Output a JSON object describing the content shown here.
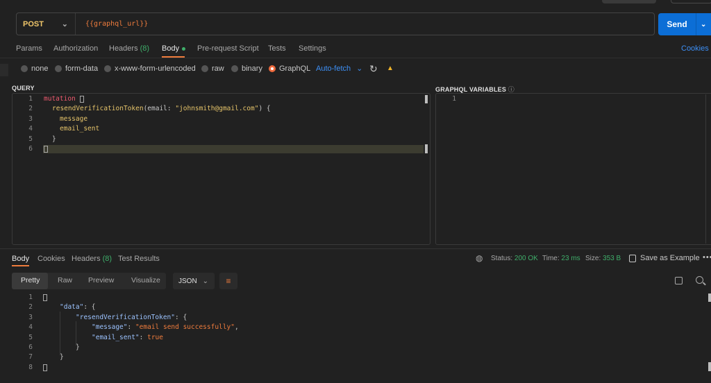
{
  "request": {
    "method": "POST",
    "url": "{{graphql_url}}",
    "send_label": "Send",
    "tabs": [
      {
        "label": "Params"
      },
      {
        "label": "Authorization"
      },
      {
        "label": "Headers",
        "count": "(8)"
      },
      {
        "label": "Body"
      },
      {
        "label": "Pre-request Script"
      },
      {
        "label": "Tests"
      },
      {
        "label": "Settings"
      }
    ],
    "cookies_label": "Cookies",
    "body_types": [
      "none",
      "form-data",
      "x-www-form-urlencoded",
      "raw",
      "binary",
      "GraphQL"
    ],
    "selected_body_type": "GraphQL",
    "auto_fetch_label": "Auto-fetch",
    "query_title": "QUERY",
    "variables_title": "GRAPHQL VARIABLES",
    "query_lines": {
      "l1_kw": "mutation",
      "l2_fn": "resendVerificationToken",
      "l2_open": "(email: ",
      "l2_str": "\"johnsmith@gmail.com\"",
      "l2_close": ") {",
      "l3": "message",
      "l4": "email_sent",
      "l5": "}"
    },
    "query_line_numbers": [
      "1",
      "2",
      "3",
      "4",
      "5",
      "6"
    ],
    "variables_line_numbers": [
      "1"
    ]
  },
  "response": {
    "tabs": [
      {
        "label": "Body"
      },
      {
        "label": "Cookies"
      },
      {
        "label": "Headers",
        "count": "(8)"
      },
      {
        "label": "Test Results"
      }
    ],
    "status_label": "Status:",
    "status_value": "200 OK",
    "time_label": "Time:",
    "time_value": "23 ms",
    "size_label": "Size:",
    "size_value": "353 B",
    "save_example_label": "Save as Example",
    "view_modes": [
      "Pretty",
      "Raw",
      "Preview",
      "Visualize"
    ],
    "selected_view_mode": "Pretty",
    "format": "JSON",
    "line_numbers": [
      "1",
      "2",
      "3",
      "4",
      "5",
      "6",
      "7",
      "8"
    ],
    "json": {
      "k_data": "\"data\"",
      "k_token": "\"resendVerificationToken\"",
      "k_message": "\"message\"",
      "v_message": "\"email send successfully\"",
      "k_email_sent": "\"email_sent\"",
      "v_email_sent": "true"
    }
  },
  "colors": {
    "accent_orange": "#ef7c3d",
    "send_blue": "#0c6ed6",
    "status_green": "#3fae6a",
    "link_blue": "#3d8ff5",
    "method_yellow": "#f1c76a"
  },
  "icons": [
    "chevron-down-icon",
    "refresh-icon",
    "warning-icon",
    "info-icon",
    "globe-icon",
    "save-icon",
    "more-icon",
    "wrap-lines-icon",
    "copy-icon",
    "search-icon"
  ]
}
